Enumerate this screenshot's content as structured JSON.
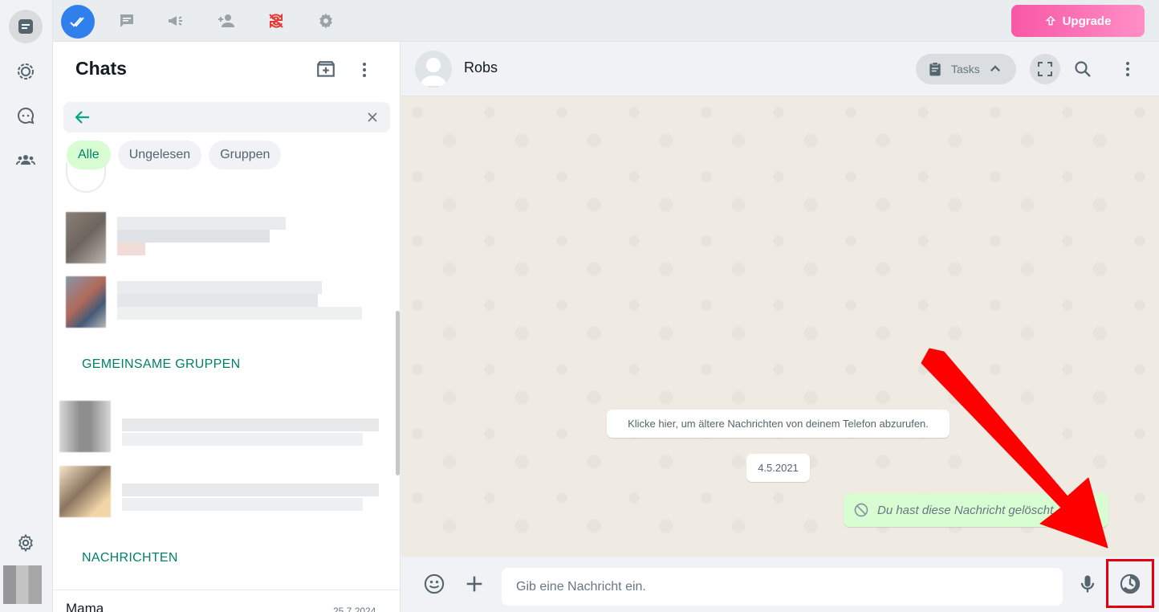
{
  "chats": {
    "title": "Chats",
    "search_value": "",
    "filters": [
      "Alle",
      "Ungelesen",
      "Gruppen"
    ],
    "section_groups": "GEMEINSAME GRUPPEN",
    "section_messages": "NACHRICHTEN",
    "last_chat_name": "Mama",
    "last_chat_date": "25.7.2024"
  },
  "topbar": {
    "upgrade_label": "Upgrade"
  },
  "conversation": {
    "contact_name": "Robs",
    "tasks_label": "Tasks",
    "older_messages_text": "Klicke hier, um ältere Nachrichten von deinem Telefon abzurufen.",
    "date_label": "4.5.2021",
    "deleted_message_text": "Du hast diese Nachricht gelöscht"
  },
  "composer": {
    "placeholder": "Gib eine Nachricht ein."
  },
  "colors": {
    "accent": "#008069",
    "upgrade": "#f857a6",
    "annotation": "#e4000f"
  }
}
